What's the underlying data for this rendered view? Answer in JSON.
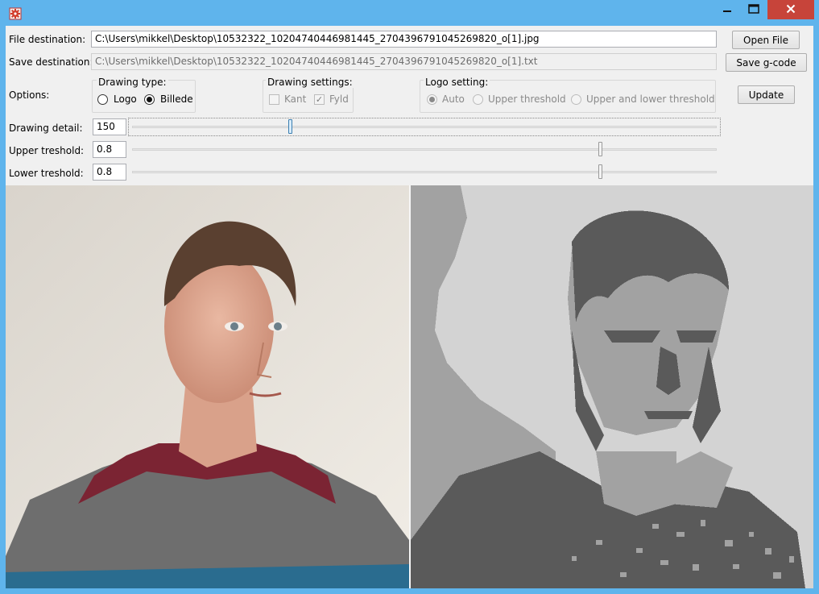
{
  "window": {
    "minimize_icon": "minimize-icon",
    "maximize_icon": "maximize-icon",
    "close_icon": "close-icon",
    "app_icon": "gear-app-icon"
  },
  "file": {
    "label": "File destination:",
    "value": "C:\\Users\\mikkel\\Desktop\\10532322_10204740446981445_2704396791045269820_o[1].jpg",
    "button": "Open File"
  },
  "save": {
    "label": "Save destination:",
    "value": "C:\\Users\\mikkel\\Desktop\\10532322_10204740446981445_2704396791045269820_o[1].txt",
    "button": "Save g-code"
  },
  "options": {
    "label": "Options:",
    "drawing_type": {
      "title": "Drawing type:",
      "logo": "Logo",
      "billede": "Billede",
      "selected": "Billede"
    },
    "drawing_settings": {
      "title": "Drawing settings:",
      "kant": "Kant",
      "fyld": "Fyld",
      "kant_checked": false,
      "fyld_checked": true
    },
    "logo_setting": {
      "title": "Logo setting:",
      "auto": "Auto",
      "upper": "Upper threshold",
      "upper_lower": "Upper and lower threshold",
      "selected": "Auto"
    },
    "update_button": "Update"
  },
  "sliders": [
    {
      "label": "Drawing detail:",
      "value": "150",
      "level": 0.27
    },
    {
      "label": "Upper treshold:",
      "value": "0.8",
      "level": 0.8
    },
    {
      "label": "Lower treshold:",
      "value": "0.8",
      "level": 0.8
    }
  ],
  "colors": {
    "title_bar": "#5fb4ec",
    "close_button": "#c7443a",
    "background_wall": "#e7e3dc",
    "sweater_maroon": "#7b2433",
    "sweater_grey": "#6e6e6e",
    "processed_light": "#d3d3d3",
    "processed_mid": "#a2a2a2",
    "processed_dark": "#5a5a5a"
  }
}
